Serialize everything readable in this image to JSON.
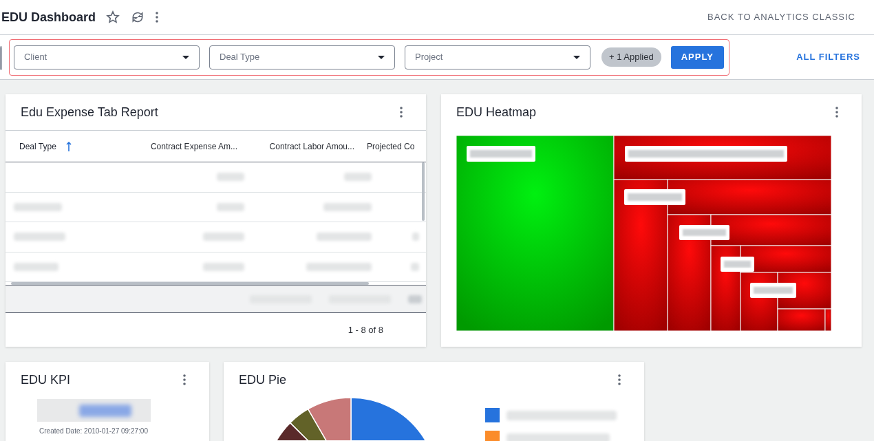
{
  "header": {
    "title": "EDU Dashboard",
    "back_link": "BACK TO ANALYTICS CLASSIC"
  },
  "filters": {
    "fields": [
      {
        "placeholder": "Client"
      },
      {
        "placeholder": "Deal Type"
      },
      {
        "placeholder": "Project"
      }
    ],
    "applied_badge": "+ 1 Applied",
    "apply_button": "APPLY",
    "all_filters_link": "ALL FILTERS"
  },
  "widgets": [
    {
      "kind": "table",
      "title": "Edu Expense Tab Report",
      "columns": [
        {
          "label": "Deal Type",
          "sorted": true
        },
        {
          "label": "Contract Expense Am...",
          "sorted": false
        },
        {
          "label": "Contract Labor Amou...",
          "sorted": false
        },
        {
          "label": "Projected Co",
          "sorted": false
        }
      ],
      "pager": "1 - 8 of 8"
    },
    {
      "kind": "heatmap",
      "title": "EDU Heatmap"
    },
    {
      "kind": "kpi",
      "title": "EDU KPI",
      "caption": "Created Date: 2010-01-27 09:27:00"
    },
    {
      "kind": "pie",
      "title": "EDU Pie",
      "legend": [
        {
          "color": "#2673dd"
        },
        {
          "color": "#fb8c2a"
        }
      ]
    }
  ]
}
